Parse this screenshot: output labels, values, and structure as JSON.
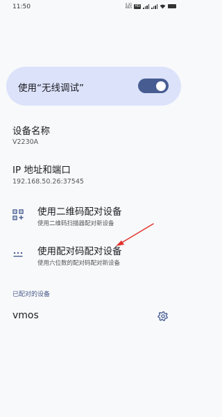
{
  "status_bar": {
    "time": "11:50",
    "net_speed_value": "0.20",
    "net_speed_unit": "KB/S",
    "network_type": "HD"
  },
  "wireless_debugging": {
    "label": "使用“无线调试”",
    "enabled": true
  },
  "device_info": {
    "name_title": "设备名称",
    "name_value": "V2230A",
    "ip_title": "IP 地址和端口",
    "ip_value": "192.168.50.26:37545"
  },
  "pairing": {
    "qr": {
      "title": "使用二维码配对设备",
      "subtitle": "使用二维码扫描器配对新设备",
      "icon": "qr-code-scanner-icon"
    },
    "code": {
      "title": "使用配对码配对设备",
      "subtitle": "使用六位数的配对码配对新设备",
      "icon": "dialpad-icon"
    }
  },
  "paired_devices": {
    "header": "已配对的设备",
    "devices": [
      {
        "name": "vmos",
        "icon": "gear-icon"
      }
    ]
  },
  "colors": {
    "accent": "#475d92",
    "card": "#dce2fa",
    "annotation": "#e0332c"
  }
}
